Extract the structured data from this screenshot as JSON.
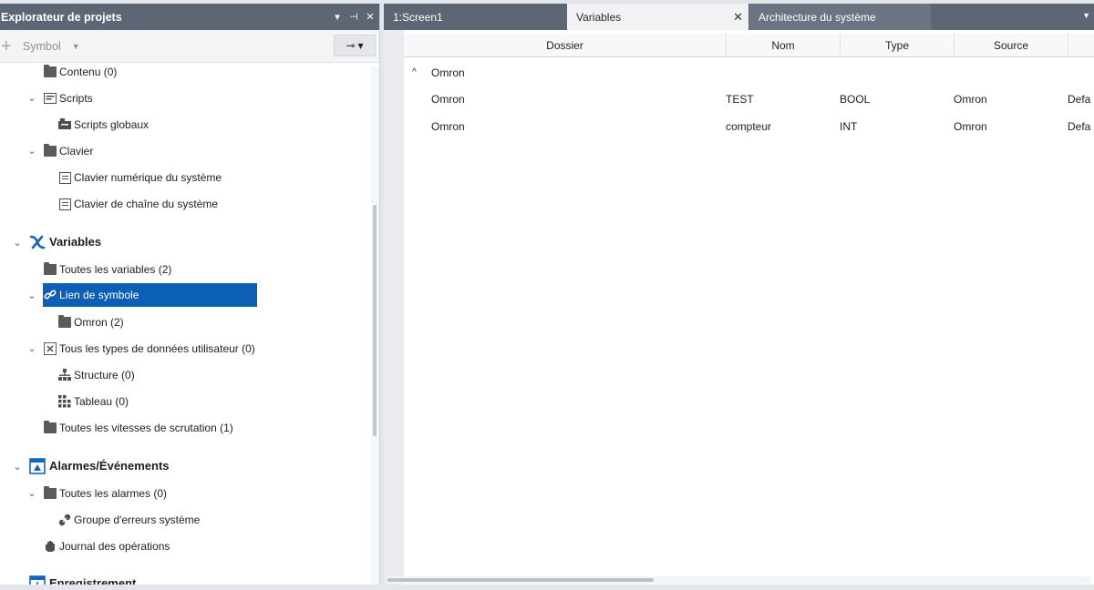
{
  "explorer": {
    "title": "Explorateur de projets",
    "controls": {
      "dropdown": "▾",
      "pin": "⊣",
      "close": "✕"
    },
    "toolbar": {
      "add": "+",
      "symbol_label": "Symbol",
      "symbol_arrow": "▼",
      "pin_glyph": "⊸",
      "pin_arrow": "▾"
    },
    "tree": {
      "contenu": "Contenu (0)",
      "scripts": "Scripts",
      "scripts_globaux": "Scripts globaux",
      "clavier": "Clavier",
      "clavier_num": "Clavier numérique du système",
      "clavier_chaine": "Clavier de chaîne du système",
      "variables": "Variables",
      "toutes_variables": "Toutes les variables (2)",
      "lien_symbole": "Lien de symbole",
      "omron": "Omron (2)",
      "types_donnees": "Tous les types de données utilisateur (0)",
      "structure": "Structure (0)",
      "tableau": "Tableau (0)",
      "vitesses": "Toutes les vitesses de scrutation (1)",
      "alarmes": "Alarmes/Événements",
      "toutes_alarmes": "Toutes les alarmes (0)",
      "groupe_erreurs": "Groupe d'erreurs système",
      "journal": "Journal des opérations",
      "enregistrement": "Enregistrement"
    }
  },
  "tabs": [
    {
      "label": "1:Screen1"
    },
    {
      "label": "Variables",
      "close": "✕"
    },
    {
      "label": "Architecture du système"
    }
  ],
  "tab_menu": "▼",
  "grid": {
    "columns": [
      "Dossier",
      "Nom",
      "Type",
      "Source"
    ],
    "group": {
      "toggle": "^",
      "label": "Omron"
    },
    "rows": [
      {
        "dossier": "Omron",
        "nom": "TEST",
        "type": "BOOL",
        "source": "Omron",
        "extra": "Defa"
      },
      {
        "dossier": "Omron",
        "nom": "compteur",
        "type": "INT",
        "source": "Omron",
        "extra": "Defa"
      }
    ]
  },
  "colors": {
    "header_bg": "#5c6674",
    "selection": "#0b5fb6",
    "variables_icon": "#1565c0"
  }
}
